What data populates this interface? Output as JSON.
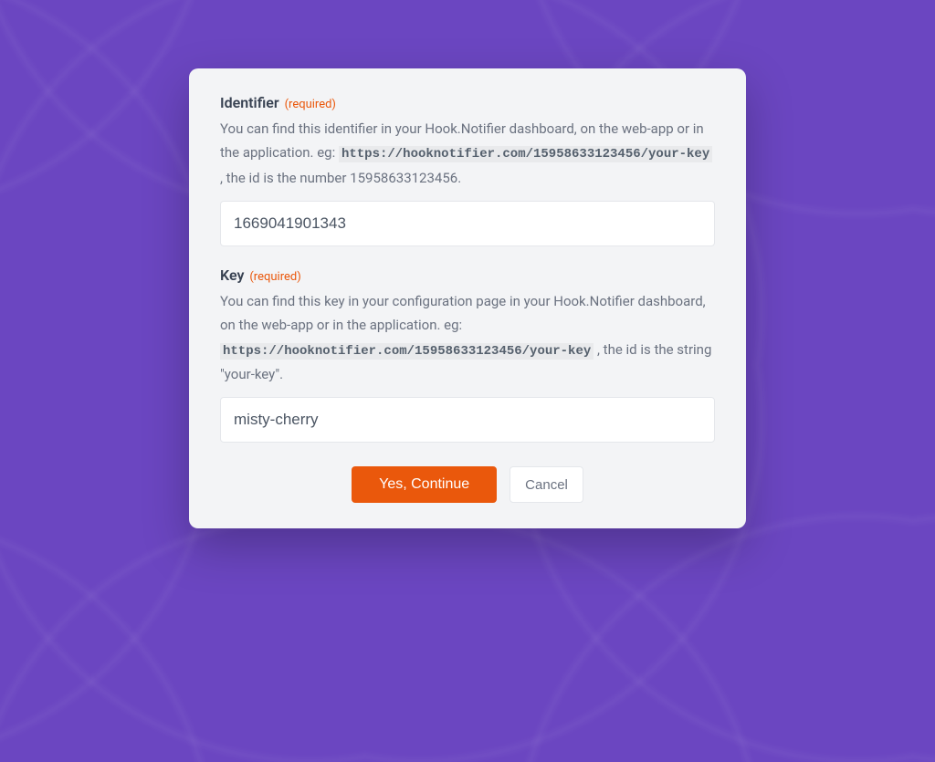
{
  "fields": {
    "identifier": {
      "label": "Identifier",
      "required_text": "(required)",
      "help_pre": "You can find this identifier in your Hook.Notifier dashboard, on the web-app or in the application. eg: ",
      "help_code": "https://hooknotifier.com/15958633123456/your-key",
      "help_post": " , the id is the number 15958633123456.",
      "value": "1669041901343"
    },
    "key": {
      "label": "Key",
      "required_text": "(required)",
      "help_pre": "You can find this key in your configuration page in your Hook.Notifier dashboard, on the web-app or in the application. eg: ",
      "help_code": "https://hooknotifier.com/15958633123456/your-key",
      "help_post": " , the id is the string \"your-key\".",
      "value": "misty-cherry"
    }
  },
  "buttons": {
    "continue": "Yes, Continue",
    "cancel": "Cancel"
  }
}
